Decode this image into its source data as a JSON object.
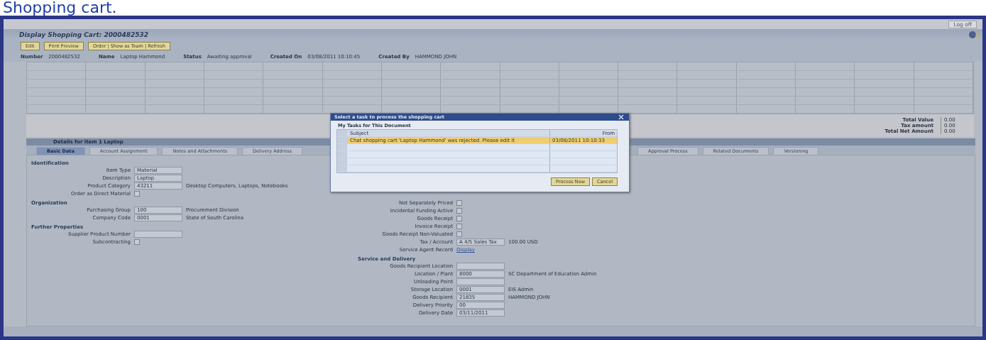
{
  "page_heading": "Shopping cart.",
  "top_link": "Log off",
  "window": {
    "title": "Display Shopping Cart: 2000482532"
  },
  "toolbar": [
    "Edit",
    "Print Preview",
    "Order | Show as Team | Refresh"
  ],
  "header_fields": [
    {
      "label": "Number",
      "value": "2000482532"
    },
    {
      "label": "Name",
      "value": "Laptop Hammond"
    },
    {
      "label": "Status",
      "value": "Awaiting approval"
    },
    {
      "label": "Created On",
      "value": "03/08/2011 10:10:45"
    },
    {
      "label": "Created By",
      "value": "HAMMOND JOHN"
    }
  ],
  "totals": [
    {
      "label": "Total Value",
      "value": "0.00"
    },
    {
      "label": "Tax amount",
      "value": "0.00"
    },
    {
      "label": "Total Net Amount",
      "value": "0.00"
    }
  ],
  "details": {
    "title": "Details for item 1 Laptop",
    "tabs": [
      {
        "label": "Basic Data",
        "selected": true
      },
      {
        "label": "Account Assignment",
        "selected": false
      },
      {
        "label": "Notes and Attachments",
        "selected": false
      },
      {
        "label": "Delivery Address",
        "selected": false
      },
      {
        "label": "Approval Process",
        "selected": false
      },
      {
        "label": "Related Documents",
        "selected": false
      },
      {
        "label": "Versioning",
        "selected": false
      }
    ],
    "left_sections": [
      {
        "title": "Identification",
        "rows": [
          {
            "kind": "field",
            "label": "Item Type",
            "value": "Material",
            "extra": ""
          },
          {
            "kind": "field",
            "label": "Description",
            "value": "Laptop",
            "extra": ""
          },
          {
            "kind": "field",
            "label": "Product Category",
            "value": "43211",
            "extra": "Desktop Computers, Laptops, Notebooks"
          },
          {
            "kind": "check",
            "label": "Order as Direct Material",
            "checked": false
          }
        ]
      },
      {
        "title": "Organization",
        "rows": [
          {
            "kind": "field",
            "label": "Purchasing Group",
            "value": "100",
            "extra": "Procurement Division"
          },
          {
            "kind": "field",
            "label": "Company Code",
            "value": "0001",
            "extra": "State of South Carolina"
          }
        ]
      },
      {
        "title": "Further Properties",
        "rows": [
          {
            "kind": "field",
            "label": "Supplier Product Number",
            "value": "",
            "extra": ""
          },
          {
            "kind": "check",
            "label": "Subcontracting",
            "checked": false
          }
        ]
      }
    ],
    "right_sections": [
      {
        "rows": [
          {
            "kind": "check",
            "label": "Not Separately Priced",
            "checked": false
          },
          {
            "kind": "check",
            "label": "Incidental Funding Active",
            "checked": false
          },
          {
            "kind": "check",
            "label": "Goods Receipt",
            "checked": false
          },
          {
            "kind": "check",
            "label": "Invoice Receipt",
            "checked": false
          },
          {
            "kind": "check",
            "label": "Goods Receipt Non-Valuated",
            "checked": false
          },
          {
            "kind": "field",
            "label": "Tax / Account",
            "value": "A 4/5 Sales Tax",
            "extra": "100.00 USD"
          },
          {
            "kind": "link",
            "label": "Service Agent Record",
            "value": "Display"
          }
        ]
      },
      {
        "title": "Service and Delivery",
        "rows": [
          {
            "kind": "field",
            "label": "Goods Recipient Location",
            "value": "",
            "extra": ""
          },
          {
            "kind": "field",
            "label": "Location / Plant",
            "value": "8000",
            "extra": "SC Department of Education Admin"
          },
          {
            "kind": "field",
            "label": "Unloading Point",
            "value": "",
            "extra": ""
          },
          {
            "kind": "field",
            "label": "Storage Location",
            "value": "0001",
            "extra": "EIS Admin"
          },
          {
            "kind": "field",
            "label": "Goods Recipient",
            "value": "21835",
            "extra": "HAMMOND JOHN"
          },
          {
            "kind": "field",
            "label": "Delivery Priority",
            "value": "00",
            "extra": ""
          },
          {
            "kind": "field",
            "label": "Delivery Date",
            "value": "03/11/2011",
            "extra": ""
          }
        ]
      }
    ]
  },
  "dialog": {
    "title": "Select a task to process the shopping cart",
    "section": "My Tasks for This Document",
    "columns": [
      "Subject",
      "From"
    ],
    "rows": [
      {
        "subject": "Chat shopping cart 'Laptop Hammond' was rejected. Please edit it",
        "from": "03/08/2011 10:10:33",
        "selected": true
      }
    ],
    "buttons": [
      "Process Now",
      "Cancel"
    ]
  }
}
